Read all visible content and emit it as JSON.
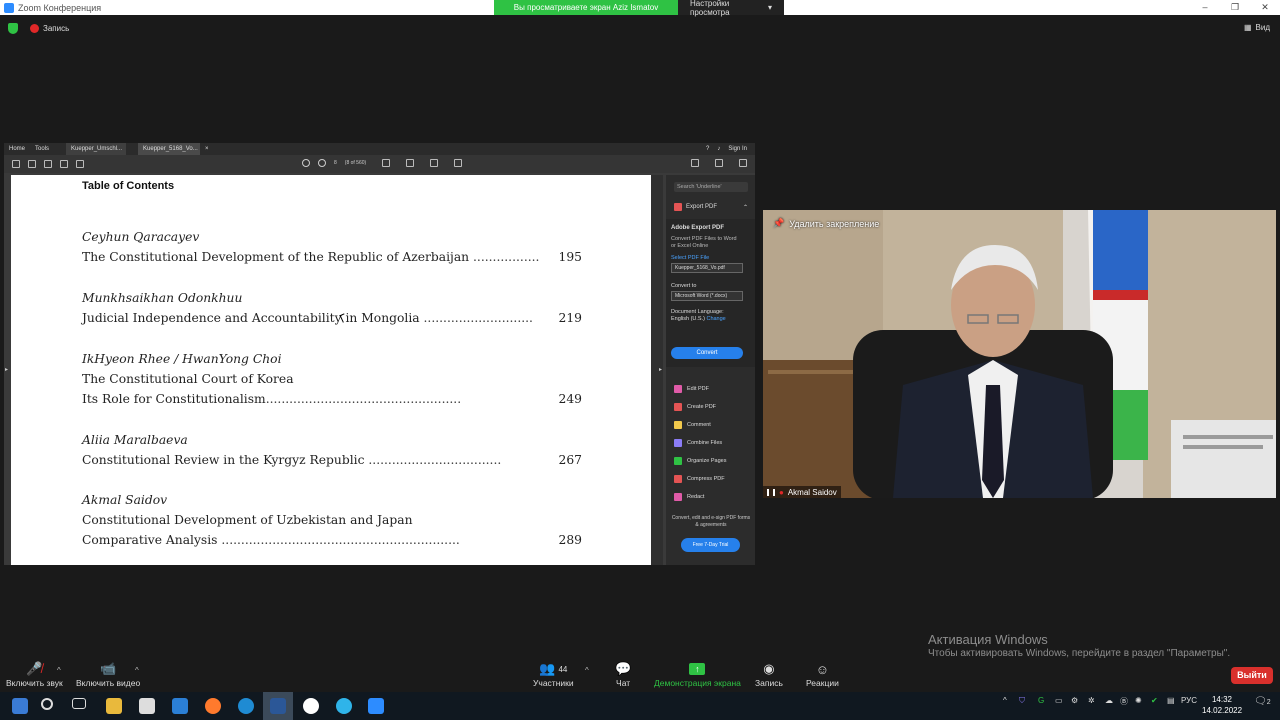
{
  "window": {
    "title": "Zoom Конференция",
    "share_banner": "Вы просматриваете экран Aziz Ismatov",
    "view_options": "Настройки просмотра",
    "controls": [
      "‒",
      "❐",
      "✕"
    ]
  },
  "topbar": {
    "recording_label": "Запись",
    "view_label": "Вид"
  },
  "acrobat": {
    "tabs": {
      "home": "Home",
      "tools": "Tools",
      "doc1": "Kuepper_Umschl...",
      "doc2": "Kuepper_5168_Vo...",
      "help": "?",
      "sign_in": "Sign In"
    },
    "toolbar": {
      "page_num": "8",
      "page_total": "(8 of 560)"
    },
    "toc": {
      "heading": "Table of Contents",
      "entries": [
        {
          "author": "Ceyhun Qaracayev",
          "lines": [
            {
              "text": "The Constitutional Development of the Republic of Azerbaijan",
              "dots": " .................",
              "page": "195"
            }
          ]
        },
        {
          "author": "Munkhsaikhan Odonkhuu",
          "lines": [
            {
              "text": "Judicial Independence and Accountability in Mongolia",
              "dots": " ............................",
              "page": "219"
            }
          ]
        },
        {
          "author": "IkHyeon Rhee / HwanYong Choi",
          "lines": [
            {
              "text": "The Constitutional Court of Korea",
              "dots": "",
              "page": ""
            },
            {
              "text": "Its Role for Constitutionalism",
              "dots": "..................................................",
              "page": "249"
            }
          ]
        },
        {
          "author": "Aliia Maralbaeva",
          "lines": [
            {
              "text": "Constitutional Review in the Kyrgyz Republic",
              "dots": " ..................................",
              "page": "267"
            }
          ]
        },
        {
          "author": "Akmal Saidov",
          "lines": [
            {
              "text": "Constitutional Development of Uzbekistan and Japan",
              "dots": "",
              "page": ""
            },
            {
              "text": "Comparative Analysis",
              "dots": " .............................................................",
              "page": "289"
            }
          ]
        }
      ]
    },
    "panel": {
      "search_placeholder": "Search 'Underline'",
      "export_label": "Export PDF",
      "box_title": "Adobe Export PDF",
      "box_desc": "Convert PDF Files to Word or Excel Online",
      "select_file": "Select PDF File",
      "file_name": "Kuepper_5168_Vo.pdf",
      "convert_to": "Convert to",
      "convert_option": "Microsoft Word (*.docx)",
      "doc_lang": "Document Language:",
      "lang_value": "English (U.S.)",
      "change": "Change",
      "convert_button": "Convert",
      "tools": [
        {
          "label": "Edit PDF",
          "color": "#e05ba8"
        },
        {
          "label": "Create PDF",
          "color": "#e45454"
        },
        {
          "label": "Comment",
          "color": "#f2c94c"
        },
        {
          "label": "Combine Files",
          "color": "#8b7cf6"
        },
        {
          "label": "Organize Pages",
          "color": "#2fc244"
        },
        {
          "label": "Compress PDF",
          "color": "#e45454"
        },
        {
          "label": "Redact",
          "color": "#e05ba8"
        }
      ],
      "promo": "Convert, edit and e-sign PDF forms & agreements",
      "trial": "Free 7-Day Trial"
    }
  },
  "video": {
    "unpin": "Удалить закрепление",
    "participant": "Akmal Saidov"
  },
  "watermark": {
    "title": "Активация Windows",
    "subtitle": "Чтобы активировать Windows, перейдите в раздел \"Параметры\"."
  },
  "controls": {
    "audio": "Включить звук",
    "video": "Включить видео",
    "participants": "Участники",
    "participants_count": "44",
    "chat": "Чат",
    "share": "Демонстрация экрана",
    "record": "Запись",
    "reactions": "Реакции",
    "exit": "Выйти"
  },
  "taskbar": {
    "lang": "РУС",
    "time": "14:32",
    "date": "14.02.2022",
    "notifications": "2"
  }
}
